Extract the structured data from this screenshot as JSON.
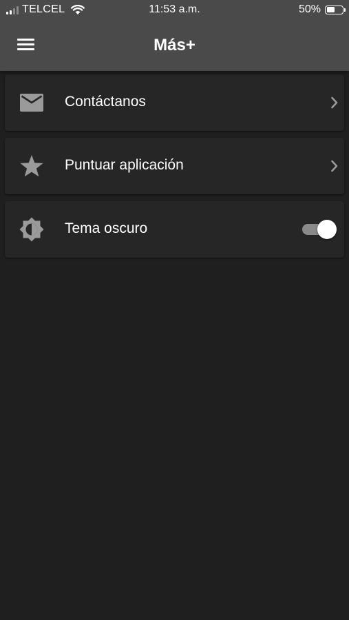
{
  "status_bar": {
    "carrier": "TELCEL",
    "time": "11:53 a.m.",
    "battery_percent": "50%",
    "battery_level": 0.5,
    "signal_bars": 2,
    "icons": [
      "signal-icon",
      "wifi-icon",
      "battery-icon"
    ]
  },
  "header": {
    "title": "Más+",
    "menu_icon": "hamburger-menu-icon"
  },
  "menu_items": [
    {
      "label": "Contáctanos",
      "icon": "mail-icon",
      "trailing": "chevron-right-icon"
    },
    {
      "label": "Puntuar aplicación",
      "icon": "star-icon",
      "trailing": "chevron-right-icon"
    },
    {
      "label": "Tema oscuro",
      "icon": "brightness-icon",
      "trailing": "toggle",
      "toggle_on": true
    }
  ],
  "colors": {
    "background": "#1f1f1f",
    "app_bar": "#4a4a4a",
    "card": "#262626",
    "icon": "#9a9a9a",
    "text": "#ffffff"
  }
}
